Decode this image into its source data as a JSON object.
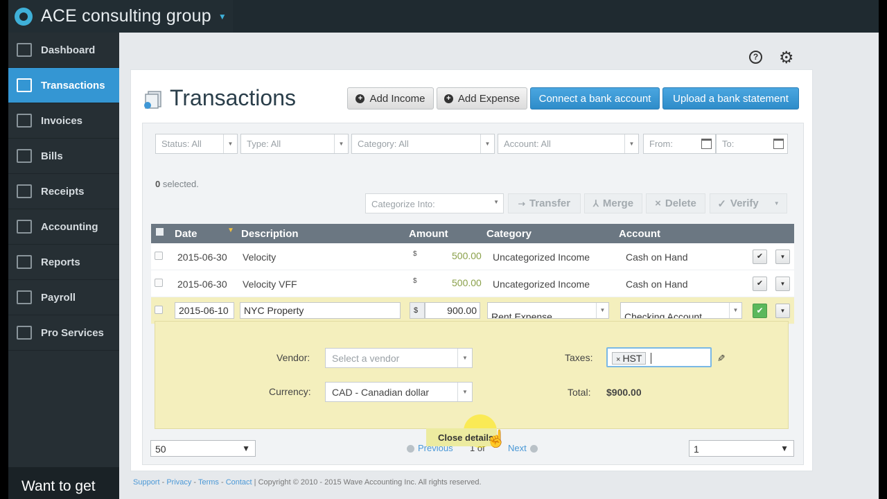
{
  "app": {
    "name": "ACE consulting group"
  },
  "sidebar": {
    "items": [
      {
        "label": "Dashboard",
        "active": false
      },
      {
        "label": "Transactions",
        "active": true
      },
      {
        "label": "Invoices",
        "active": false
      },
      {
        "label": "Bills",
        "active": false
      },
      {
        "label": "Receipts",
        "active": false
      },
      {
        "label": "Accounting",
        "active": false
      },
      {
        "label": "Reports",
        "active": false
      },
      {
        "label": "Payroll",
        "active": false
      },
      {
        "label": "Pro Services",
        "active": false
      }
    ],
    "promo": "Want to get"
  },
  "header": {
    "help_icon": "?",
    "settings_icon": "gear-icon"
  },
  "page": {
    "title": "Transactions",
    "buttons": {
      "add_income": "Add Income",
      "add_expense": "Add Expense",
      "connect_bank": "Connect a bank account",
      "upload_statement": "Upload a bank statement"
    }
  },
  "filters": {
    "status": "Status: All",
    "type": "Type: All",
    "category": "Category: All",
    "account": "Account: All",
    "from_placeholder": "From:",
    "to_placeholder": "To:"
  },
  "bulk": {
    "selected_count": "0",
    "selected_suffix": " selected.",
    "categorize_into": "Categorize Into:",
    "transfer": "Transfer",
    "merge": "Merge",
    "delete": "Delete",
    "verify": "Verify"
  },
  "table": {
    "headers": {
      "date": "Date",
      "description": "Description",
      "amount": "Amount",
      "category": "Category",
      "account": "Account"
    },
    "rows": [
      {
        "date": "2015-06-30",
        "description": "Velocity",
        "currency": "$",
        "amount": "500.00",
        "category": "Uncategorized Income",
        "account": "Cash on Hand"
      },
      {
        "date": "2015-06-30",
        "description": "Velocity VFF",
        "currency": "$",
        "amount": "500.00",
        "category": "Uncategorized Income",
        "account": "Cash on Hand"
      }
    ],
    "editing": {
      "date": "2015-06-10",
      "description": "NYC Property",
      "currency": "$",
      "amount": "900.00",
      "category": "Rent Expense",
      "account": "Checking Account"
    }
  },
  "details": {
    "vendor_label": "Vendor:",
    "vendor_placeholder": "Select a vendor",
    "currency_label": "Currency:",
    "currency_value": "CAD - Canadian dollar",
    "taxes_label": "Taxes:",
    "tax_tag": "HST",
    "total_label": "Total:",
    "total_value": "$900.00",
    "close_button": "Close details"
  },
  "pagination": {
    "page_size": "50",
    "previous": "Previous",
    "of_text": "1 of",
    "next": "Next",
    "page": "1"
  },
  "footer": {
    "support": "Support",
    "privacy": "Privacy",
    "terms": "Terms",
    "contact": "Contact",
    "copyright": "Copyright © 2010 - 2015 Wave Accounting Inc. All rights reserved."
  }
}
